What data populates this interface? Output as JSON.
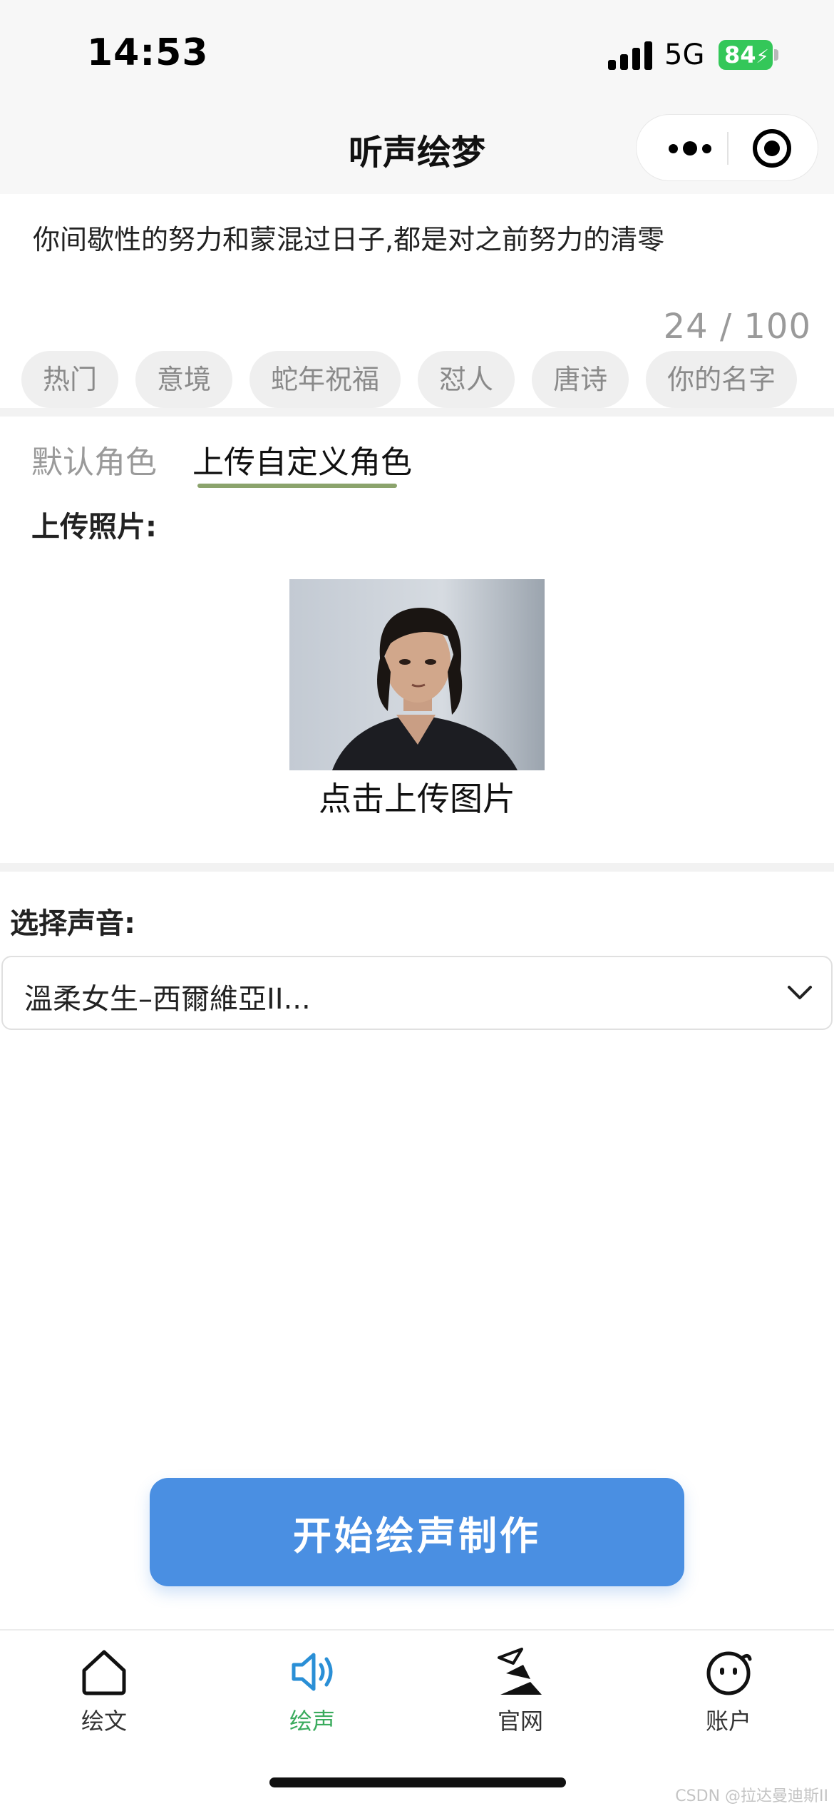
{
  "status_bar": {
    "time": "14:53",
    "network": "5G",
    "battery": "84"
  },
  "nav": {
    "title": "听声绘梦"
  },
  "text_input": {
    "value": "你间歇性的努力和蒙混过日子,都是对之前努力的清零",
    "counter": "24 / 100"
  },
  "chips": [
    "热门",
    "意境",
    "蛇年祝福",
    "怼人",
    "唐诗",
    "你的名字"
  ],
  "role_tabs": {
    "default": "默认角色",
    "custom": "上传自定义角色",
    "active": "custom"
  },
  "upload": {
    "label": "上传照片:",
    "button_text": "点击上传图片"
  },
  "voice": {
    "label": "选择声音:",
    "selected": "溫柔女生–西爾維亞II..."
  },
  "start_button": "开始绘声制作",
  "tabbar": [
    {
      "label": "绘文",
      "icon": "home-icon",
      "active": false
    },
    {
      "label": "绘声",
      "icon": "speaker-icon",
      "active": true
    },
    {
      "label": "官网",
      "icon": "website-logo-icon",
      "active": false
    },
    {
      "label": "账户",
      "icon": "smiley-account-icon",
      "active": false
    }
  ],
  "watermark": "CSDN @拉达曼迪斯II",
  "colors": {
    "accent_blue": "#4a8fe2",
    "active_green": "#3aab5d",
    "tab_underline": "#8ba36c",
    "battery_green": "#34c759"
  }
}
